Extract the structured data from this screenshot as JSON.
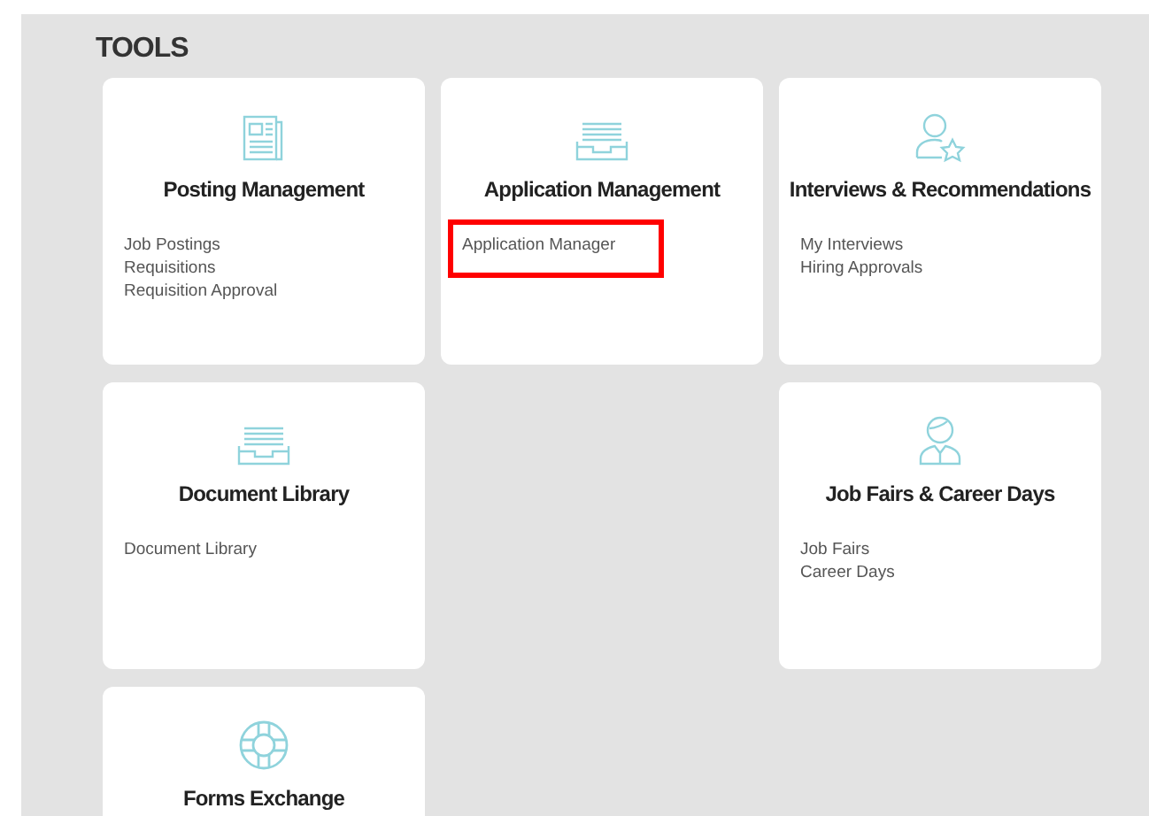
{
  "heading": "TOOLS",
  "rows": [
    [
      {
        "kind": "postings",
        "title": "Posting Management",
        "links": [
          {
            "label": "Job Postings",
            "highlighted": false
          },
          {
            "label": "Requisitions",
            "highlighted": false
          },
          {
            "label": "Requisition Approval",
            "highlighted": false
          }
        ]
      },
      {
        "kind": "tray",
        "title": "Application Management",
        "links": [
          {
            "label": "Application Manager",
            "highlighted": true
          }
        ]
      },
      {
        "kind": "person-star",
        "title": "Interviews & Recommendations",
        "links": [
          {
            "label": "My Interviews",
            "highlighted": false
          },
          {
            "label": "Hiring Approvals",
            "highlighted": false
          }
        ]
      }
    ],
    [
      {
        "kind": "tray",
        "title": "Document Library",
        "links": [
          {
            "label": "Document Library",
            "highlighted": false
          }
        ]
      },
      null,
      {
        "kind": "person-tie",
        "title": "Job Fairs & Career Days",
        "links": [
          {
            "label": "Job Fairs",
            "highlighted": false
          },
          {
            "label": "Career Days",
            "highlighted": false
          }
        ]
      }
    ],
    [
      {
        "kind": "lifebuoy",
        "title": "Forms Exchange"
      }
    ]
  ]
}
